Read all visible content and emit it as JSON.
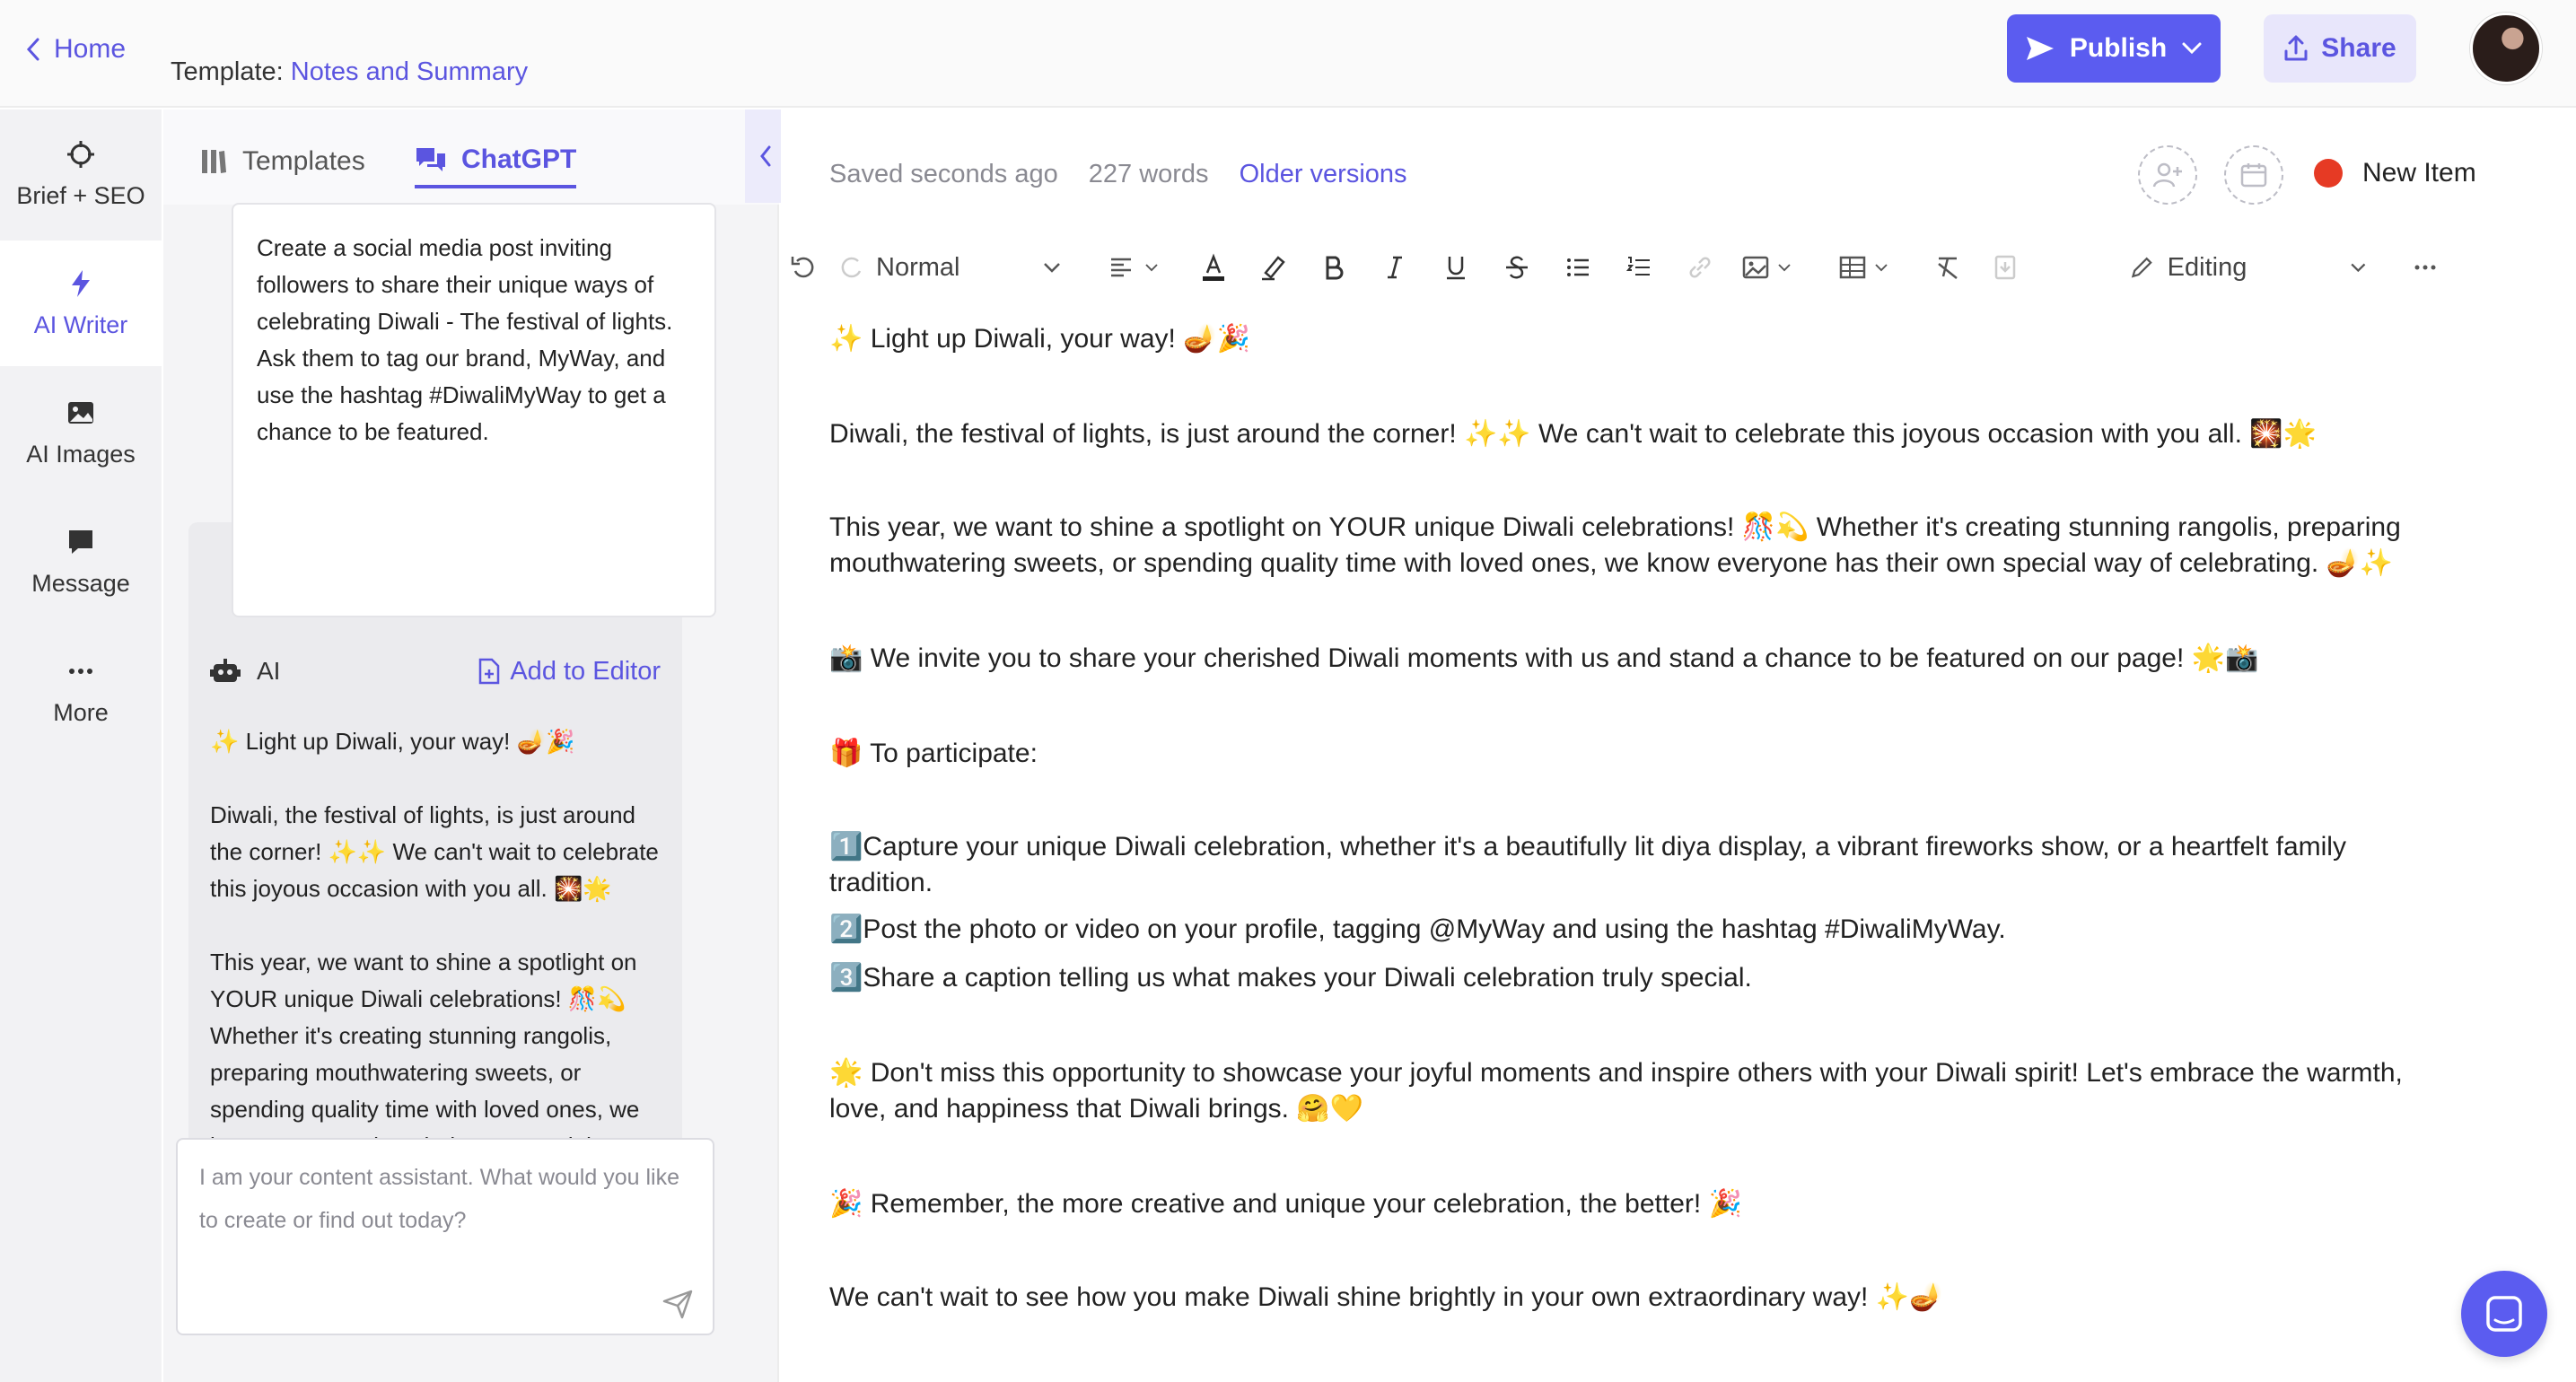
{
  "topbar": {
    "home_label": "Home",
    "template_prefix": "Template:",
    "template_name": "Notes and Summary",
    "publish_label": "Publish",
    "share_label": "Share"
  },
  "rail": {
    "items": [
      {
        "label": "Brief + SEO",
        "icon": "crosshair-icon",
        "active": false
      },
      {
        "label": "AI Writer",
        "icon": "lightning-icon",
        "active": true
      },
      {
        "label": "AI Images",
        "icon": "image-icon",
        "active": false
      },
      {
        "label": "Message",
        "icon": "message-icon",
        "active": false
      },
      {
        "label": "More",
        "icon": "more-dots-icon",
        "active": false
      }
    ]
  },
  "panel": {
    "tabs": [
      {
        "label": "Templates",
        "icon": "templates-icon",
        "active": false
      },
      {
        "label": "ChatGPT",
        "icon": "chat-bubbles-icon",
        "active": true
      }
    ],
    "prompt": "Create a social media post inviting followers to share their unique ways of celebrating Diwali - The festival of lights. Ask them to tag our brand, MyWay, and use the hashtag #DiwaliMyWay to get a chance to be featured.",
    "ai_label": "AI",
    "add_to_editor_label": "Add to Editor",
    "ai_response": [
      "✨ Light up Diwali, your way! 🪔🎉",
      "Diwali, the festival of lights, is just around the corner! ✨✨ We can't wait to celebrate this joyous occasion with you all. 🎇🌟",
      "This year, we want to shine a spotlight on YOUR unique Diwali celebrations! 🎊💫 Whether it's creating stunning rangolis, preparing mouthwatering sweets, or spending quality time with loved ones, we know everyone has their own special way of celebrating. 🪔✨"
    ],
    "input_placeholder": "I am your content assistant. What would you like to create or find out today?"
  },
  "editor": {
    "saved_status": "Saved seconds ago",
    "word_count": "227 words",
    "older_versions_label": "Older versions",
    "item_status_label": "New Item",
    "item_status_color": "#e63a24",
    "toolbar": {
      "style_value": "Normal",
      "mode_value": "Editing"
    },
    "paragraphs": [
      "✨ Light up Diwali, your way! 🪔🎉",
      "Diwali, the festival of lights, is just around the corner! ✨✨ We can't wait to celebrate this joyous occasion with you all. 🎇🌟",
      "This year, we want to shine a spotlight on YOUR unique Diwali celebrations! 🎊💫 Whether it's creating stunning rangolis, preparing mouthwatering sweets, or spending quality time with loved ones, we know everyone has their own special way of celebrating. 🪔✨",
      "📸 We invite you to share your cherished Diwali moments with us and stand a chance to be featured on our page! 🌟📸",
      "🎁 To participate:",
      "1️⃣Capture your unique Diwali celebration, whether it's a beautifully lit diya display, a vibrant fireworks show, or a heartfelt family tradition.",
      "2️⃣Post the photo or video on your profile, tagging @MyWay and using the hashtag #DiwaliMyWay.",
      "3️⃣Share a caption telling us what makes your Diwali celebration truly special.",
      "🌟 Don't miss this opportunity to showcase your joyful moments and inspire others with your Diwali spirit! Let's embrace the warmth, love, and happiness that Diwali brings. 🤗💛",
      "🎉 Remember, the more creative and unique your celebration, the better! 🎉",
      "We can't wait to see how you make Diwali shine brightly in your own extraordinary way! ✨🪔"
    ]
  },
  "colors": {
    "accent": "#5b5cf0",
    "accent_text": "#5b55e0",
    "share_bg": "#e8e6fb"
  }
}
